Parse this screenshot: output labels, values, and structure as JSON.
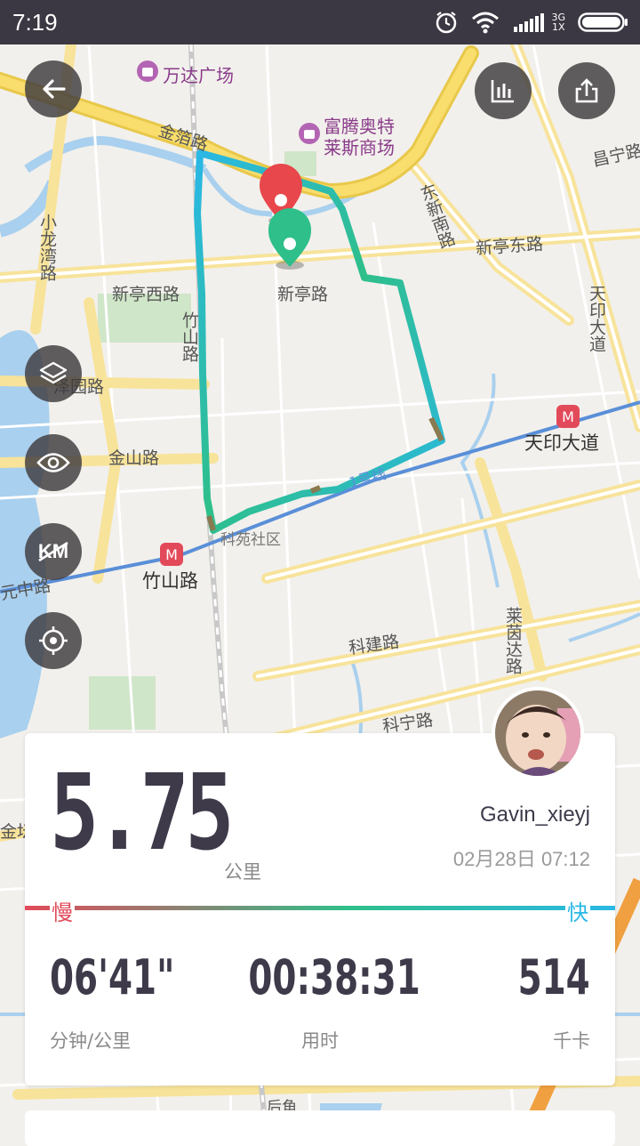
{
  "status_bar": {
    "time": "7:19",
    "network_type": "3G",
    "network_sub": "1X",
    "icons": [
      "alarm-icon",
      "wifi-icon",
      "signal-icon",
      "battery-icon"
    ]
  },
  "map": {
    "poi": [
      {
        "name": "万达广场"
      },
      {
        "name": "富腾奥特"
      },
      {
        "name": "莱斯商场"
      }
    ],
    "roads": {
      "jinjia": "金箔路",
      "dongxinnan": "东新南路",
      "changning": "昌宁路",
      "xiaolongwan": "小龙湾路",
      "xintingdong": "新亭东路",
      "xintingxi": "新亭西路",
      "xinting": "新亭路",
      "tianyin": "天印大道",
      "zhushan_rd": "竹山路",
      "yuanmen": "泽园路",
      "jinshan": "金山路",
      "yuanzhong": "元中路",
      "kejian": "科建路",
      "laiyin": "莱茵达路",
      "keyu": "科宁路",
      "line1": "1号线",
      "community": "科苑社区",
      "houjiao": "后角",
      "jinba": "金坛"
    },
    "stations": {
      "tianyin_station": "天印大道",
      "zhushan_station": "竹山路"
    }
  },
  "controls": {
    "back": "back-icon",
    "stats": "bar-chart-icon",
    "share": "share-icon",
    "layers": "layers-icon",
    "eye": "eye-icon",
    "km": "KM",
    "locate": "locate-icon"
  },
  "summary": {
    "distance": "5.75",
    "distance_unit": "公里",
    "username": "Gavin_xieyj",
    "datetime": "02月28日 07:12",
    "slow_label": "慢",
    "fast_label": "快",
    "pace_value": "06'41\"",
    "pace_label": "分钟/公里",
    "duration_value": "00:38:31",
    "duration_label": "用时",
    "calories_value": "514",
    "calories_label": "千卡"
  },
  "colors": {
    "status_bar": "#3b3843",
    "route_start": "#2ab8e6",
    "route_end": "#2fbf8a",
    "slow": "#e24a5a",
    "fast": "#2ab8e6",
    "end_marker": "#e8474c",
    "start_marker": "#2fbf8a"
  }
}
